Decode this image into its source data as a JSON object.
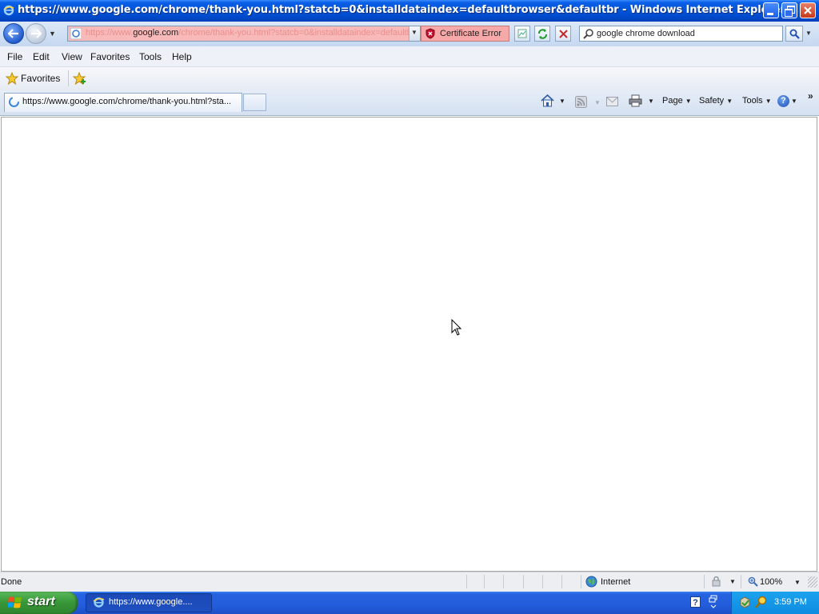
{
  "window": {
    "title": "https://www.google.com/chrome/thank-you.html?statcb=0&installdataindex=defaultbrowser&defaultbr - Windows Internet Explorer"
  },
  "address_bar": {
    "url_prefix": "https://www.",
    "url_host": "google.com",
    "url_rest": "/chrome/thank-you.html?statcb=0&installdataindex=defaultbrowser&defaultbr",
    "certificate_label": "Certificate Error"
  },
  "search": {
    "value": "google chrome download"
  },
  "menu": [
    "File",
    "Edit",
    "View",
    "Favorites",
    "Tools",
    "Help"
  ],
  "favorites_bar": {
    "favorites_label": "Favorites"
  },
  "tabs": [
    {
      "label": "https://www.google.com/chrome/thank-you.html?sta..."
    }
  ],
  "command_bar": {
    "page_label": "Page",
    "safety_label": "Safety",
    "tools_label": "Tools"
  },
  "status_bar": {
    "status": "Done",
    "zone": "Internet",
    "zoom": "100%"
  },
  "taskbar": {
    "start_label": "start",
    "task_label": "https://www.google....",
    "clock": "3:59 PM"
  },
  "colors": {
    "titlebar_blue": "#0254d8",
    "cert_error_bg": "#f7a9a9",
    "taskbar_blue": "#245ddb",
    "start_green": "#379637"
  }
}
